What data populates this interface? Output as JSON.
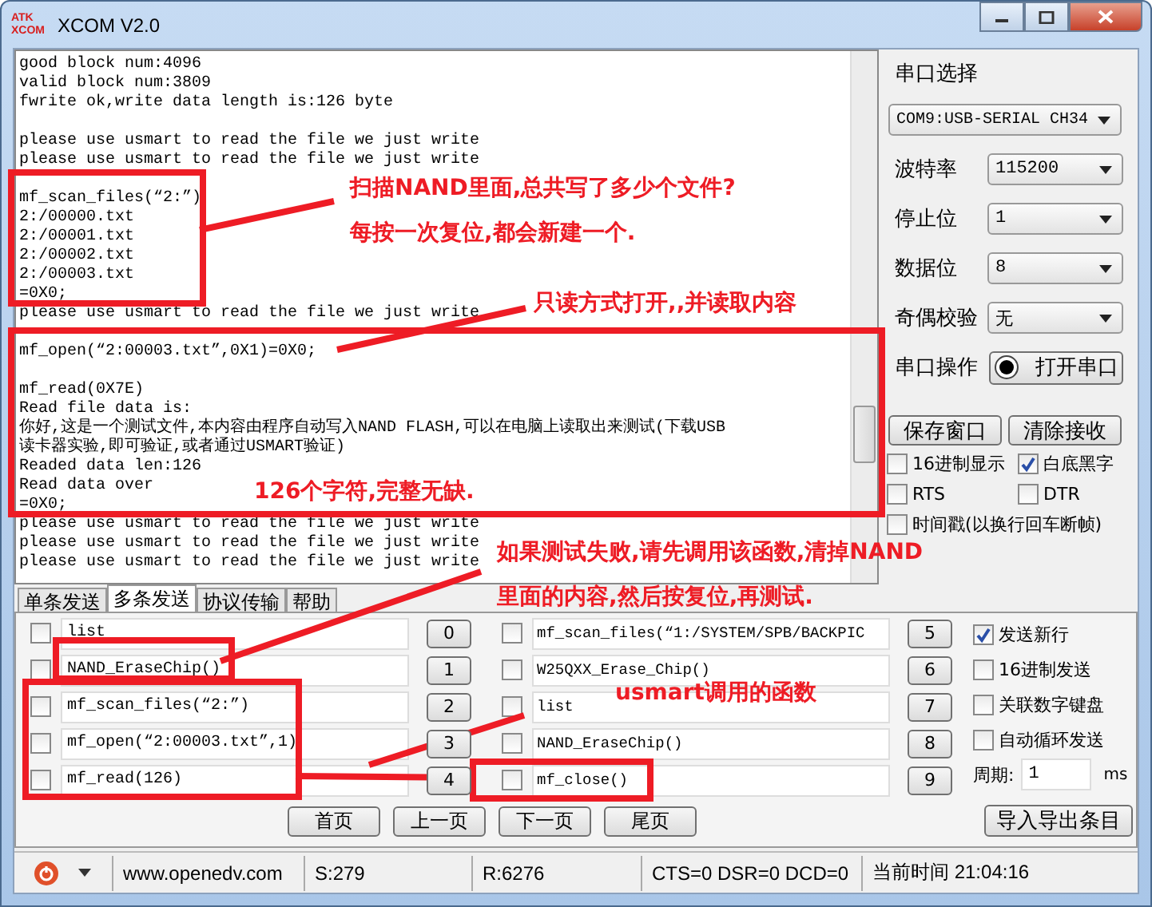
{
  "window": {
    "logo": [
      "ATK",
      "XCOM"
    ],
    "title": "XCOM V2.0"
  },
  "terminal": {
    "blocks": [
      [
        "good block num:4096",
        "valid block num:3809",
        "fwrite ok,write data length is:126 byte"
      ],
      [
        "please use usmart to read the file we just write",
        "please use usmart to read the file we just write"
      ],
      [
        "mf_scan_files(“2:”)",
        "2:/00000.txt",
        "2:/00001.txt",
        "2:/00002.txt",
        "2:/00003.txt",
        "=0X0;",
        "please use usmart to read the file we just write"
      ],
      [
        "mf_open(“2:00003.txt”,0X1)=0X0;"
      ],
      [
        "mf_read(0X7E)",
        "Read file data is:",
        "你好,这是一个测试文件,本内容由程序自动写入NAND FLASH,可以在电脑上读取出来测试(下载USB",
        "读卡器实验,即可验证,或者通过USMART验证)",
        "Readed data len:126",
        "Read data over",
        "=0X0;",
        "please use usmart to read the file we just write",
        "please use usmart to read the file we just write",
        "please use usmart to read the file we just write"
      ]
    ]
  },
  "serial": {
    "port_label": "串口选择",
    "port": "COM9:USB-SERIAL CH34",
    "settings": [
      {
        "label": "波特率",
        "value": "115200"
      },
      {
        "label": "停止位",
        "value": "1"
      },
      {
        "label": "数据位",
        "value": "8"
      },
      {
        "label": "奇偶校验",
        "value": "无"
      }
    ],
    "operation_label": "串口操作",
    "open_button": "打开串口",
    "buttons": [
      "保存窗口",
      "清除接收"
    ],
    "checks": [
      {
        "label": "16进制显示",
        "checked": false
      },
      {
        "label": "白底黑字",
        "checked": true
      },
      {
        "label": "RTS",
        "checked": false
      },
      {
        "label": "DTR",
        "checked": false
      },
      {
        "label": "时间戳(以换行回车断帧)",
        "checked": false
      }
    ]
  },
  "tabs": [
    {
      "label": "单条发送",
      "selected": false
    },
    {
      "label": "多条发送",
      "selected": true
    },
    {
      "label": "协议传输",
      "selected": false
    },
    {
      "label": "帮助",
      "selected": false
    }
  ],
  "multi_send": {
    "rows": [
      {
        "checked": false,
        "command": "list",
        "button": "0"
      },
      {
        "checked": false,
        "command": "NAND_EraseChip()",
        "button": "1"
      },
      {
        "checked": false,
        "command": "mf_scan_files(“2:”)",
        "button": "2"
      },
      {
        "checked": false,
        "command": "mf_open(“2:00003.txt”,1)",
        "button": "3"
      },
      {
        "checked": false,
        "command": "mf_read(126)",
        "button": "4"
      },
      {
        "checked": false,
        "command": "mf_scan_files(“1:/SYSTEM/SPB/BACKPIC",
        "button": "5"
      },
      {
        "checked": false,
        "command": "W25QXX_Erase_Chip()",
        "button": "6"
      },
      {
        "checked": false,
        "command": "list",
        "button": "7"
      },
      {
        "checked": false,
        "command": "NAND_EraseChip()",
        "button": "8"
      },
      {
        "checked": false,
        "command": "mf_close()",
        "button": "9"
      }
    ],
    "options": [
      {
        "label": "发送新行",
        "checked": true
      },
      {
        "label": "16进制发送",
        "checked": false
      },
      {
        "label": "关联数字键盘",
        "checked": false
      },
      {
        "label": "自动循环发送",
        "checked": false
      }
    ],
    "period": {
      "label": "周期:",
      "value": "1",
      "unit": "ms"
    },
    "pages": [
      "首页",
      "上一页",
      "下一页",
      "尾页"
    ],
    "import_button": "导入导出条目"
  },
  "status_bar": {
    "site": "www.openedv.com",
    "sent": "S:279",
    "received": "R:6276",
    "signals": "CTS=0 DSR=0 DCD=0",
    "time": "当前时间 21:04:16"
  },
  "annotations": [
    {
      "text": "扫描NAND里面,总共写了多少个文件?"
    },
    {
      "text": "每按一次复位,都会新建一个."
    },
    {
      "text": "只读方式打开,,并读取内容"
    },
    {
      "text": "126个字符,完整无缺."
    },
    {
      "text": "如果测试失败,请先调用该函数,清掉NAND"
    },
    {
      "text": "里面的内容,然后按复位,再测试."
    },
    {
      "text": "usmart调用的函数"
    }
  ]
}
